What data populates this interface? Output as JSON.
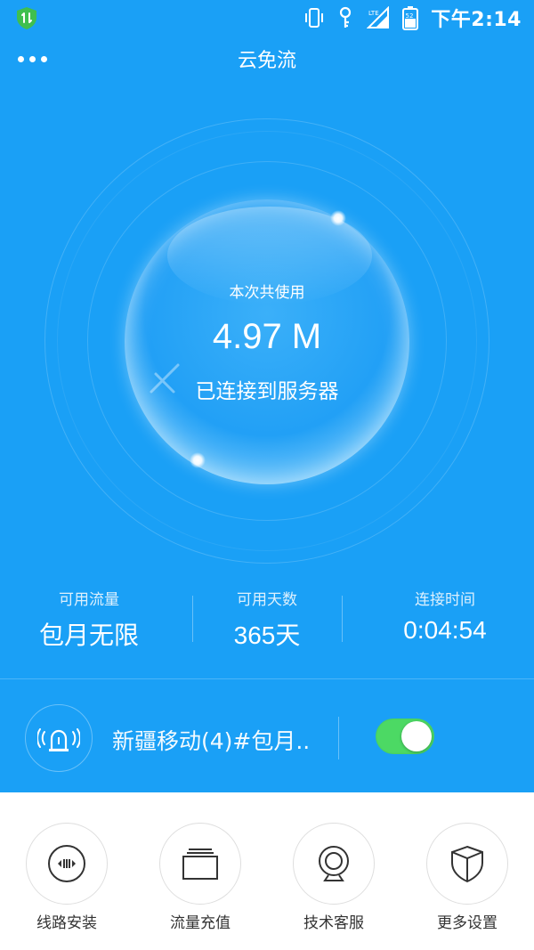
{
  "status_bar": {
    "time": "下午2:14",
    "icons": [
      "shield-app-icon",
      "vibrate-icon",
      "key-icon",
      "lte-signal-icon",
      "battery-icon"
    ],
    "battery_level": "52",
    "network_label": "LTE"
  },
  "header": {
    "title": "云免流",
    "menu_icon": "more-dots-icon"
  },
  "usage": {
    "label": "本次共使用",
    "value": "4.97 M",
    "status": "已连接到服务器"
  },
  "stats": [
    {
      "label": "可用流量",
      "value": "包月无限"
    },
    {
      "label": "可用天数",
      "value": "365天"
    },
    {
      "label": "连接时间",
      "value": "0:04:54"
    }
  ],
  "line": {
    "name": "新疆移动(4)#包月..",
    "toggle_on": true,
    "icon": "alarm-light-icon"
  },
  "bottom_menu": [
    {
      "label": "线路安装",
      "icon": "line-install-icon"
    },
    {
      "label": "流量充值",
      "icon": "recharge-icon"
    },
    {
      "label": "技术客服",
      "icon": "webcam-support-icon"
    },
    {
      "label": "更多设置",
      "icon": "shield-settings-icon"
    }
  ],
  "colors": {
    "primary": "#1aa0f6",
    "toggle_on": "#4cd964",
    "text_dark": "#333333"
  }
}
